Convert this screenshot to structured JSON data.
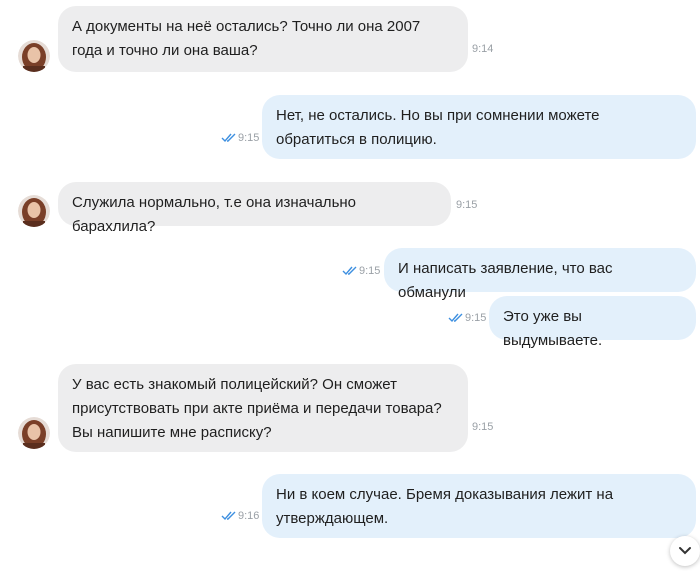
{
  "messages": [
    {
      "direction": "in",
      "text": "А документы на неё остались? Точно ли она 2007 года и точно ли она ваша?",
      "time": "9:14"
    },
    {
      "direction": "out",
      "text": "Нет, не остались. Но вы при сомнении можете обратиться в полицию.",
      "time": "9:15",
      "status": "read"
    },
    {
      "direction": "in",
      "text": "Служила нормально, т.е она изначально барахлила?",
      "time": "9:15"
    },
    {
      "direction": "out",
      "text": "И написать заявление, что вас обманули",
      "time": "9:15",
      "status": "read"
    },
    {
      "direction": "out",
      "text": "Это уже вы выдумываете.",
      "time": "9:15",
      "status": "read"
    },
    {
      "direction": "in",
      "text": "У вас есть знакомый полицейский? Он сможет присутствовать при акте приёма и передачи товара? Вы напишите мне расписку?",
      "time": "9:15"
    },
    {
      "direction": "out",
      "text": "Ни в коем случае. Бремя доказывания лежит на утверждающем.",
      "time": "9:16",
      "status": "read"
    }
  ],
  "icons": {
    "read_receipt": "double-check-icon",
    "scroll_down": "chevron-down-icon"
  },
  "colors": {
    "incoming_bubble": "#ededee",
    "outgoing_bubble": "#e3f0fb",
    "read_check": "#3d8fe0",
    "timestamp": "#9aa0a6"
  }
}
